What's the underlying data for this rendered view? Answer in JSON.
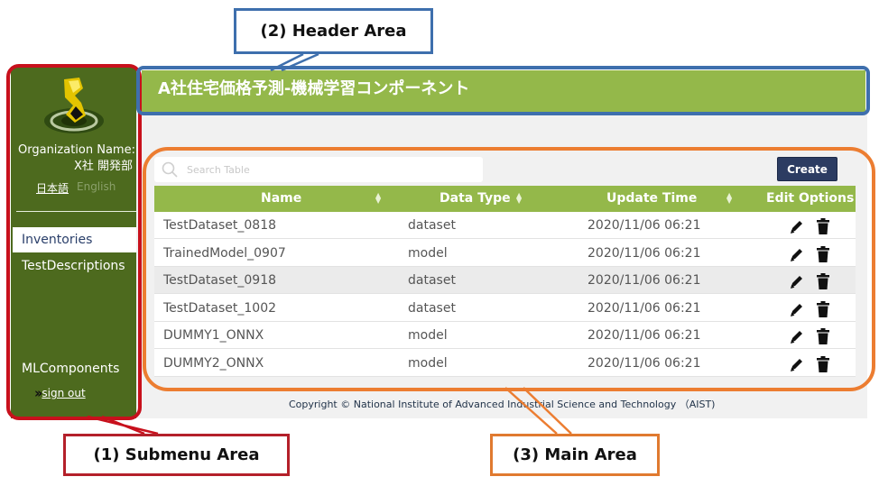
{
  "sidebar": {
    "org_label": "Organization Name:",
    "org_value": "X社 開発部",
    "lang_ja": "日本語",
    "lang_en": "English",
    "nav": [
      "Inventories",
      "TestDescriptions",
      "MLComponents"
    ],
    "signout": "sign out",
    "active_item": "Inventories",
    "colors": {
      "bg": "#4d6a1e",
      "active_bg": "#ffffff"
    }
  },
  "header": {
    "title": "A社住宅価格予測-機械学習コンポーネント",
    "color": "#94b84a"
  },
  "main": {
    "search": {
      "placeholder": "Search Table"
    },
    "create_label": "Create",
    "table": {
      "columns": [
        "Name",
        "Data Type",
        "Update Time",
        "Edit Options"
      ],
      "rows": [
        {
          "name": "TestDataset_0818",
          "type": "dataset",
          "time": "2020/11/06 06:21"
        },
        {
          "name": "TrainedModel_0907",
          "type": "model",
          "time": "2020/11/06 06:21"
        },
        {
          "name": "TestDataset_0918",
          "type": "dataset",
          "time": "2020/11/06 06:21"
        },
        {
          "name": "TestDataset_1002",
          "type": "dataset",
          "time": "2020/11/06 06:21"
        },
        {
          "name": "DUMMY1_ONNX",
          "type": "model",
          "time": "2020/11/06 06:21"
        },
        {
          "name": "DUMMY2_ONNX",
          "type": "model",
          "time": "2020/11/06 06:21"
        }
      ],
      "row_icons": [
        "pencil-icon",
        "trash-icon"
      ]
    },
    "copyright": "Copyright © National Institute of Advanced Industrial Science and Technology （AIST)"
  },
  "callouts": {
    "header": "(2) Header Area",
    "submenu": "(1) Submenu Area",
    "main": "(3) Main Area",
    "colors": {
      "header": "#3e6fad",
      "submenu": "#c8101c",
      "main": "#ec7d31"
    }
  }
}
